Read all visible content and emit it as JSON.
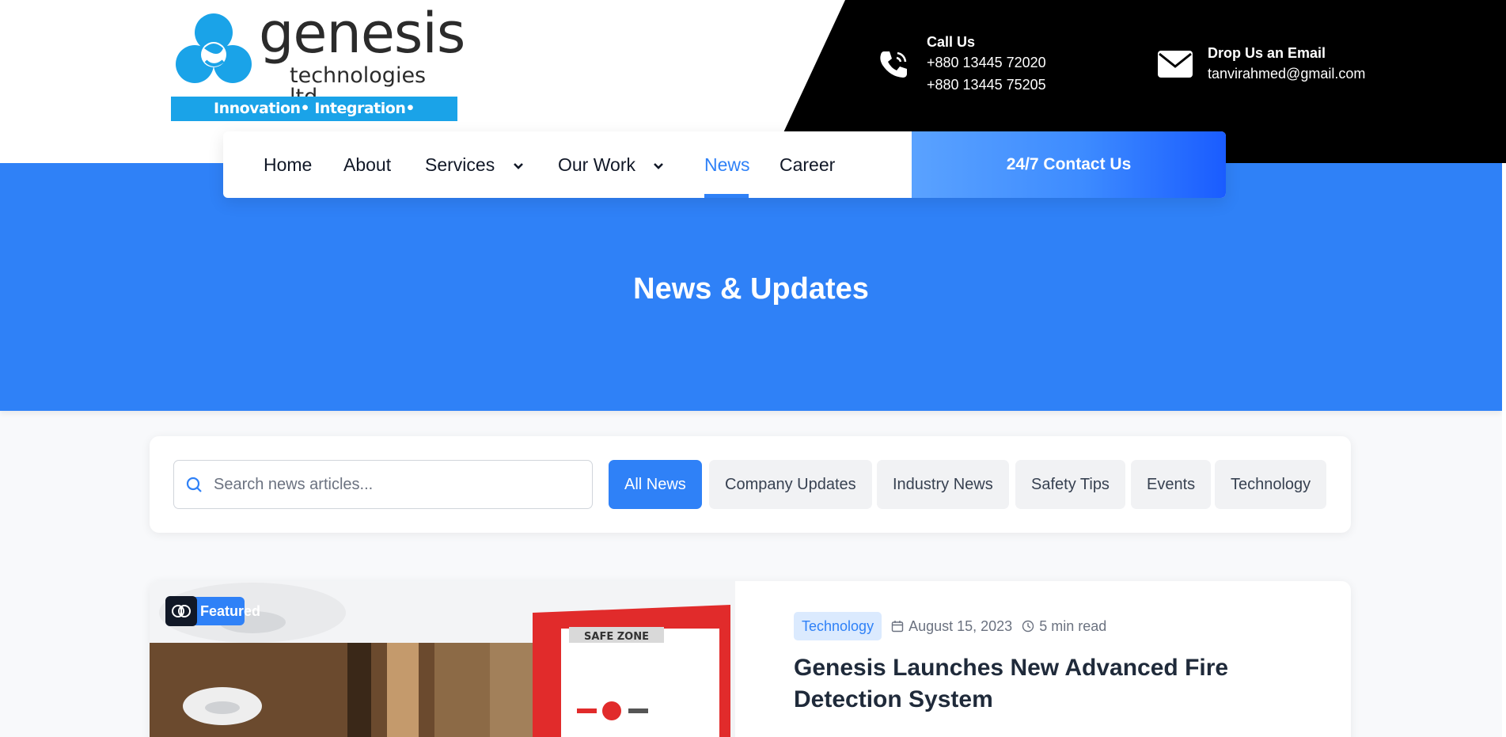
{
  "brand": {
    "name": "genesis",
    "subtitle": "technologies ltd",
    "tagline": "Innovation• Integration• Implementation",
    "colors": {
      "primary": "#2f81f7",
      "logo_blue": "#1aa3e8",
      "dark": "#000000"
    }
  },
  "contact": {
    "phone": {
      "icon": "phone-icon",
      "title": "Call Us",
      "numbers": [
        "+880 13445 72020",
        "+880 13445 75205"
      ]
    },
    "email": {
      "icon": "envelope-icon",
      "title": "Drop Us an Email",
      "address": "tanvirahmed@gmail.com"
    }
  },
  "nav": {
    "items": [
      {
        "label": "Home"
      },
      {
        "label": "About"
      },
      {
        "label": "Services",
        "dropdown": true
      },
      {
        "label": "Our Work",
        "dropdown": true
      },
      {
        "label": "News",
        "active": true
      },
      {
        "label": "Career"
      }
    ],
    "cta_label": "24/7 Contact Us"
  },
  "hero": {
    "title": "News & Updates"
  },
  "filters": {
    "search_placeholder": "Search news articles...",
    "categories": [
      {
        "label": "All News",
        "active": true
      },
      {
        "label": "Company Updates"
      },
      {
        "label": "Industry News"
      },
      {
        "label": "Safety Tips"
      },
      {
        "label": "Events"
      },
      {
        "label": "Technology"
      }
    ]
  },
  "featured_article": {
    "badge": "Featured",
    "category": "Technology",
    "date": "August 15, 2023",
    "read_time": "5 min read",
    "title": "Genesis Launches New Advanced Fire Detection System",
    "image_text": "SAFE ZONE"
  }
}
